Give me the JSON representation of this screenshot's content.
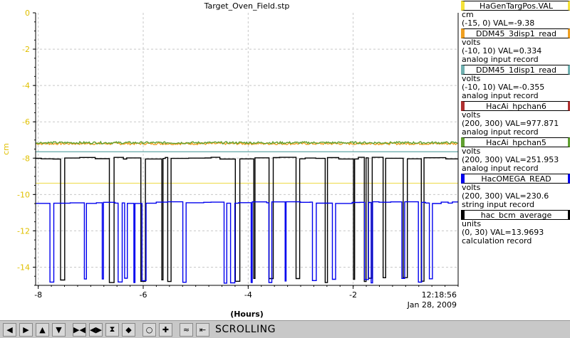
{
  "chart_data": {
    "type": "line",
    "title": "Target_Oven_Field.stp",
    "xlabel": "(Hours)",
    "ylabel": "cm",
    "xlim": [
      -8.05,
      0.0
    ],
    "ylim": [
      -15,
      0
    ],
    "x_ticks": [
      -8,
      -6,
      -4,
      -2
    ],
    "y_ticks": [
      0,
      -2,
      -4,
      -6,
      -8,
      -10,
      -12,
      -14
    ],
    "grid": true,
    "time_label": "12:18:56",
    "date_label": "Jan 28, 2009",
    "series": [
      {
        "name": "HaGenTargPos.VAL",
        "color": "#f0e060",
        "kind": "flat",
        "value": -9.38
      },
      {
        "name": "DDM45_3disp1_read",
        "color": "#f0a020",
        "kind": "noisy",
        "value": -7.2
      },
      {
        "name": "DDM45_1disp1_read",
        "color": "#70b0b0",
        "kind": "flat",
        "value": -7.65
      },
      {
        "name": "HacAi_hpchan5",
        "color": "#60a030",
        "kind": "noisy",
        "value": -7.15
      },
      {
        "name": "hac_bcm_average",
        "color": "#000000",
        "kind": "switching",
        "high": -8.0,
        "low": -14.85
      },
      {
        "name": "HacOMEGA_READ",
        "color": "#0000ee",
        "kind": "switching",
        "high": -10.45,
        "low": -14.9
      }
    ]
  },
  "legend": [
    {
      "name": "HaGenTargPos.VAL",
      "color": "#f5e23a",
      "units": "cm",
      "range": "(-15, 0) VAL=-9.38",
      "record": ""
    },
    {
      "name": "DDM45_3disp1_read",
      "color": "#f0a020",
      "units": "volts",
      "range": "(-10, 10) VAL=0.334",
      "record": "analog input record"
    },
    {
      "name": "DDM45_1disp1_read",
      "color": "#70b0b0",
      "units": "volts",
      "range": "(-10, 10) VAL=-0.355",
      "record": "analog input record"
    },
    {
      "name": "HacAi_hpchan6",
      "color": "#b03030",
      "units": "volts",
      "range": "(200, 300) VAL=977.871",
      "record": "analog input record"
    },
    {
      "name": "HacAi_hpchan5",
      "color": "#60a030",
      "units": "volts",
      "range": "(200, 300) VAL=251.953",
      "record": "analog input record"
    },
    {
      "name": "HacOMEGA_READ",
      "color": "#0000ee",
      "units": "volts",
      "range": "(200, 300) VAL=230.6",
      "record": "string input record"
    },
    {
      "name": "hac_bcm_average",
      "color": "#000000",
      "units": "units",
      "range": "(0, 30) VAL=13.9693",
      "record": "calculation record"
    }
  ],
  "toolbar": {
    "buttons": [
      {
        "icon": "arrow-left-icon",
        "glyph": "◀"
      },
      {
        "icon": "arrow-right-icon",
        "glyph": "▶"
      },
      {
        "icon": "arrow-up-icon",
        "glyph": "▲"
      },
      {
        "icon": "arrow-down-icon",
        "glyph": "▼"
      },
      {
        "icon": "zoom-in-x-icon",
        "glyph": "▶◀"
      },
      {
        "icon": "zoom-out-x-icon",
        "glyph": "◀▶"
      },
      {
        "icon": "zoom-in-y-icon",
        "glyph": "⧗"
      },
      {
        "icon": "zoom-out-y-icon",
        "glyph": "◆"
      },
      {
        "icon": "reset-icon",
        "glyph": "○"
      },
      {
        "icon": "add-icon",
        "glyph": "✚"
      },
      {
        "icon": "plot-config-icon",
        "glyph": "≈"
      },
      {
        "icon": "scroll-mode-icon",
        "glyph": "⇤"
      }
    ],
    "status": "SCROLLING"
  }
}
